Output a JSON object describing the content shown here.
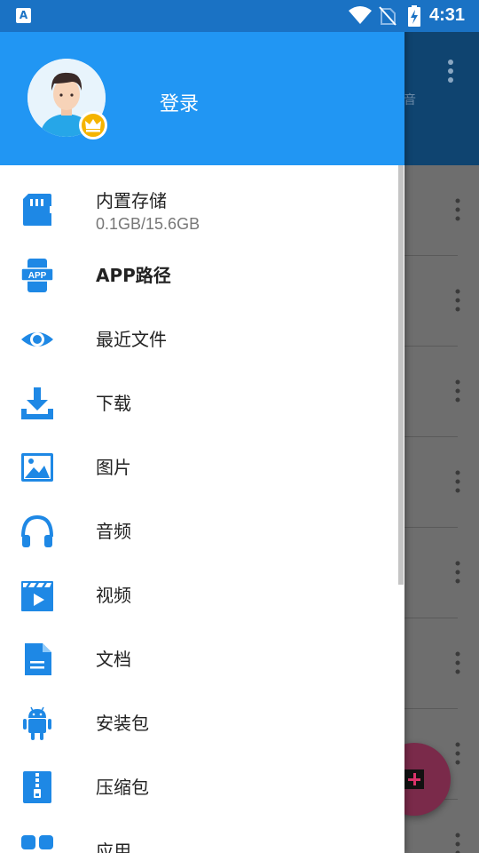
{
  "status_bar": {
    "notification_icon": "font-a-icon",
    "time": "4:31"
  },
  "drawer": {
    "header": {
      "login_label": "登录",
      "avatar_icon": "user-avatar-icon",
      "badge_icon": "crown-icon"
    },
    "items": [
      {
        "label": "内置存储",
        "sublabel": "0.1GB/15.6GB",
        "icon": "sd-card-icon"
      },
      {
        "label": "APP路径",
        "icon": "app-phone-icon"
      },
      {
        "label": "最近文件",
        "icon": "eye-icon"
      },
      {
        "label": "下载",
        "icon": "download-icon"
      },
      {
        "label": "图片",
        "icon": "image-icon"
      },
      {
        "label": "音频",
        "icon": "headphones-icon"
      },
      {
        "label": "视频",
        "icon": "video-icon"
      },
      {
        "label": "文档",
        "icon": "document-icon"
      },
      {
        "label": "安装包",
        "icon": "android-icon"
      },
      {
        "label": "压缩包",
        "icon": "zip-icon"
      },
      {
        "label": "应用",
        "icon": "apps-icon"
      }
    ]
  },
  "background": {
    "toolbar_ghost_text": "音"
  },
  "colors": {
    "primary": "#2196f3",
    "icon_blue": "#1e88e5",
    "status_bar": "#1a72c4",
    "accent_fab": "#d8336a"
  }
}
